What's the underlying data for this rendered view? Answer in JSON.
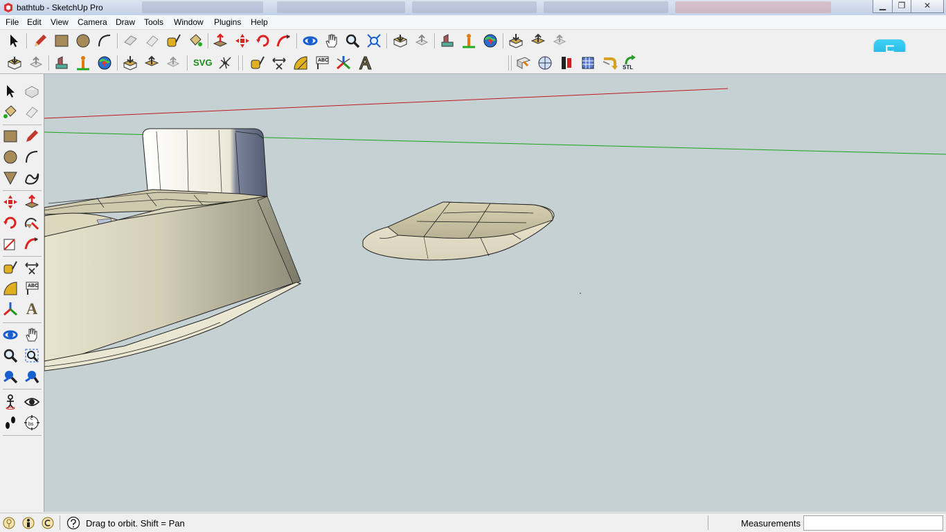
{
  "window": {
    "title": "bathtub - SketchUp Pro",
    "controls": {
      "minimize": "▁",
      "maximize": "❐",
      "close": "✕"
    }
  },
  "menu": {
    "items": [
      "File",
      "Edit",
      "View",
      "Camera",
      "Draw",
      "Tools",
      "Window",
      "Plugins",
      "Help"
    ]
  },
  "toolbar": {
    "svg_label": "SVG",
    "stl_label": "STL",
    "abc_label": "ABC",
    "badge_label": "F"
  },
  "left_toolbar": {
    "letter_a": "A",
    "camera_c": "c",
    "camera_bs": "bs"
  },
  "status": {
    "hint": "Drag to orbit.  Shift = Pan",
    "measurements_label": "Measurements",
    "measurements_value": ""
  },
  "colors": {
    "viewport_bg": "#c6d1d4",
    "red_axis": "#c0181c",
    "green_axis": "#1aa51a",
    "surface_light": "#e9e4cf",
    "surface_shade": "#9d9b86",
    "edge": "#1a1a1a",
    "f_badge": "#2bbfeb"
  }
}
